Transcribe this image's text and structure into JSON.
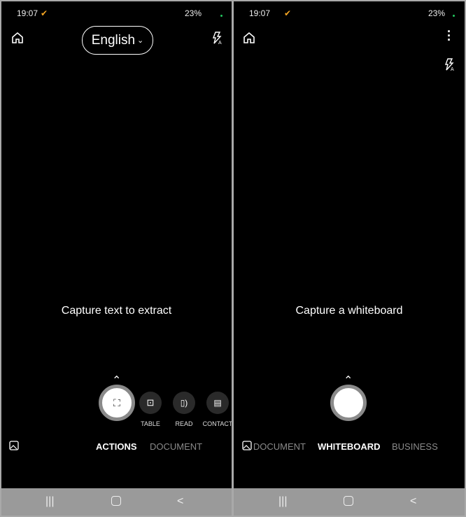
{
  "left": {
    "status": {
      "time": "19:07",
      "battery": "23%"
    },
    "language": "English",
    "hint": "Capture text to extract",
    "actions": [
      {
        "label": "TABLE",
        "icon": "table-scan-icon"
      },
      {
        "label": "READ",
        "icon": "read-aloud-icon"
      },
      {
        "label": "CONTACT",
        "icon": "contact-card-icon"
      }
    ],
    "modes": {
      "active": "ACTIONS",
      "next": "DOCUMENT"
    }
  },
  "right": {
    "status": {
      "time": "19:07",
      "battery": "23%"
    },
    "hint": "Capture a whiteboard",
    "modes": {
      "prev": "DOCUMENT",
      "active": "WHITEBOARD",
      "next": "BUSINESS"
    }
  },
  "colors": {
    "status_dot": "#22c55e",
    "check": "#f5a623",
    "navbar": "#9a9a9a"
  }
}
